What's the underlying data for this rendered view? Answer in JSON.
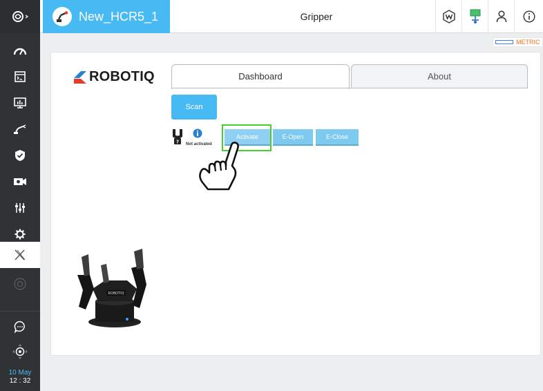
{
  "header": {
    "project_name": "New_HCR5_1",
    "title": "Gripper"
  },
  "sidebar": {
    "items": [
      {
        "icon": "speedometer-icon"
      },
      {
        "icon": "program-icon"
      },
      {
        "icon": "monitor-icon"
      },
      {
        "icon": "robot-arm-icon"
      },
      {
        "icon": "safety-shield-icon"
      },
      {
        "icon": "camera-icon"
      },
      {
        "icon": "sliders-icon"
      },
      {
        "icon": "settings-gear-icon"
      },
      {
        "icon": "plugin-x-icon",
        "active": true
      },
      {
        "icon": "target-icon"
      }
    ],
    "date_day": "10 May",
    "time": "12 : 32"
  },
  "metric_label": "METRIC",
  "brand": "ROBOTIQ",
  "tabs": [
    {
      "label": "Dashboard",
      "active": true
    },
    {
      "label": "About",
      "active": false
    }
  ],
  "buttons": {
    "scan": "Scan",
    "activate": "Activate",
    "e_open": "E-Open",
    "e_close": "E-Close"
  },
  "gripper_status": "Not activated",
  "colors": {
    "accent": "#47b9f3",
    "sidebar": "#2f3336",
    "highlight": "#46d02c",
    "metric": "#f07020"
  }
}
